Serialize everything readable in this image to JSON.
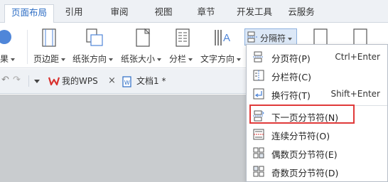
{
  "ribbon_tabs": [
    {
      "label": "页面布局",
      "active": true
    },
    {
      "label": "引用",
      "active": false
    },
    {
      "label": "审阅",
      "active": false
    },
    {
      "label": "视图",
      "active": false
    },
    {
      "label": "章节",
      "active": false
    },
    {
      "label": "开发工具",
      "active": false
    },
    {
      "label": "云服务",
      "active": false
    }
  ],
  "ribbon_buttons": {
    "effects": "果",
    "margins": "页边距",
    "orientation": "纸张方向",
    "size": "纸张大小",
    "columns": "分栏",
    "text_direction": "文字方向",
    "breaks": "分隔符"
  },
  "doc_tabs": {
    "wps_home": "我的WPS",
    "doc1": "文档1 *"
  },
  "break_menu": {
    "items": [
      {
        "label": "分页符(P)",
        "shortcut": "Ctrl+Enter",
        "icon": "page-break-icon"
      },
      {
        "label": "分栏符(C)",
        "shortcut": "",
        "icon": "column-break-icon"
      },
      {
        "label": "换行符(T)",
        "shortcut": "Shift+Enter",
        "icon": "line-break-icon"
      },
      {
        "label": "下一页分节符(N)",
        "shortcut": "",
        "icon": "next-page-section-break-icon"
      },
      {
        "label": "连续分节符(O)",
        "shortcut": "",
        "icon": "continuous-section-break-icon"
      },
      {
        "label": "偶数页分节符(E)",
        "shortcut": "",
        "icon": "even-page-section-break-icon"
      },
      {
        "label": "奇数页分节符(D)",
        "shortcut": "",
        "icon": "odd-page-section-break-icon"
      }
    ],
    "highlighted_index": 3
  },
  "colors": {
    "accent_blue": "#2b6cc4",
    "highlight_red": "#e03a3a",
    "canvas_gray": "#c9cccf",
    "wps_red": "#d9322f"
  }
}
